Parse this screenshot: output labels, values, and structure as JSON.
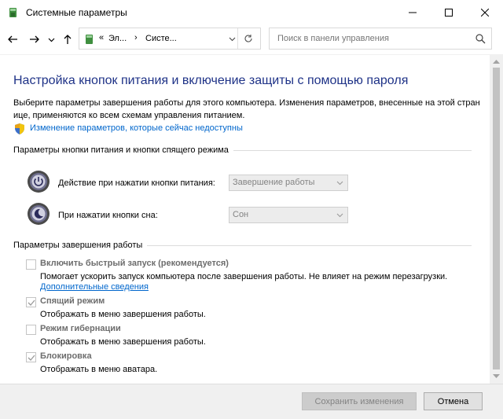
{
  "window": {
    "title": "Системные параметры",
    "controls": [
      "minimize-icon",
      "maximize-icon",
      "close-icon"
    ]
  },
  "nav": {
    "back_icon": "arrow-left-icon",
    "forward_icon": "arrow-right-icon",
    "recent_icon": "chevron-down-icon",
    "up_icon": "arrow-up-icon",
    "breadcrumb": [
      "«",
      "Эл...",
      "›",
      "Систе..."
    ],
    "search_placeholder": "Поиск в панели управления"
  },
  "page": {
    "title": "Настройка кнопок питания и включение защиты с помощью пароля",
    "description_line1": "Выберите параметры завершения работы для этого компьютера. Изменения параметров, внесенные на этой стран",
    "description_line2": "ице, применяются ко всем схемам управления питанием.",
    "change_link": "Изменение параметров, которые сейчас недоступны"
  },
  "power_group": {
    "label": "Параметры кнопки питания и кнопки спящего режима",
    "rows": [
      {
        "label": "Действие при нажатии кнопки питания:",
        "value": "Завершение работы",
        "icon": "power-button-icon"
      },
      {
        "label": "При нажатии кнопки сна:",
        "value": "Сон",
        "icon": "sleep-button-icon"
      }
    ]
  },
  "shutdown_group": {
    "label": "Параметры завершения работы",
    "options": [
      {
        "label": "Включить быстрый запуск (рекомендуется)",
        "desc": "Помогает ускорить запуск компьютера после завершения работы. Не влияет на режим перезагрузки.",
        "link": "Дополнительные сведения",
        "checked": false
      },
      {
        "label": "Спящий режим",
        "desc": "Отображать в меню завершения работы.",
        "checked": true
      },
      {
        "label": "Режим гибернации",
        "desc": "Отображать в меню завершения работы.",
        "checked": false
      },
      {
        "label": "Блокировка",
        "desc": "Отображать в меню аватара.",
        "checked": true
      }
    ]
  },
  "footer": {
    "save_label": "Сохранить изменения",
    "cancel_label": "Отмена"
  },
  "colors": {
    "title_blue": "#1e3287",
    "link_blue": "#0066cc",
    "disabled_text": "#6d6d6d"
  }
}
